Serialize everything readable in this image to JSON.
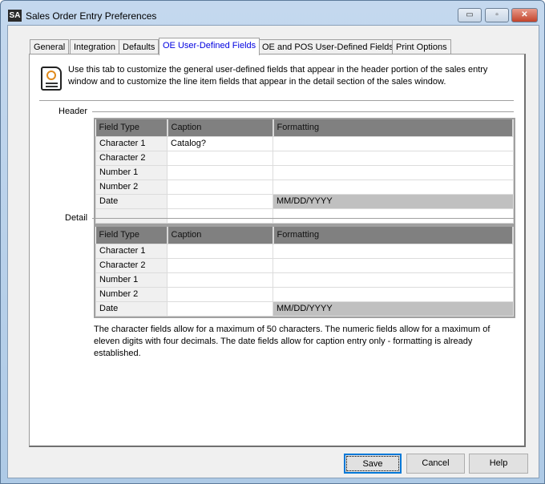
{
  "window": {
    "app_icon": "SA",
    "title": "Sales Order Entry Preferences",
    "minimize": "▭",
    "maximize": "▫",
    "close": "✕"
  },
  "tabs": [
    {
      "label": "General"
    },
    {
      "label": "Integration"
    },
    {
      "label": "Defaults"
    },
    {
      "label": "OE User-Defined Fields"
    },
    {
      "label": "OE and POS User-Defined Fields"
    },
    {
      "label": "Print Options"
    }
  ],
  "intro": "Use this tab to customize the general user-defined fields that appear in the header portion of the sales entry window and to customize the line item fields that appear in the detail section of the sales window.",
  "header": {
    "label": "Header",
    "columns": [
      "Field Type",
      "Caption",
      "Formatting"
    ],
    "rows": [
      {
        "type": "Character 1",
        "caption": "Catalog?",
        "format": ""
      },
      {
        "type": "Character 2",
        "caption": "",
        "format": ""
      },
      {
        "type": "Number 1",
        "caption": "",
        "format": ""
      },
      {
        "type": "Number 2",
        "caption": "",
        "format": ""
      },
      {
        "type": "Date",
        "caption": "",
        "format": "MM/DD/YYYY"
      }
    ]
  },
  "detail": {
    "label": "Detail",
    "columns": [
      "Field Type",
      "Caption",
      "Formatting"
    ],
    "rows": [
      {
        "type": "Character 1",
        "caption": "",
        "format": ""
      },
      {
        "type": "Character 2",
        "caption": "",
        "format": ""
      },
      {
        "type": "Number 1",
        "caption": "",
        "format": ""
      },
      {
        "type": "Number 2",
        "caption": "",
        "format": ""
      },
      {
        "type": "Date",
        "caption": "",
        "format": "MM/DD/YYYY"
      }
    ]
  },
  "note": "The character fields allow for a maximum of 50 characters.  The numeric fields allow for a maximum of eleven digits with four decimals.  The date fields allow for caption entry only - formatting is already established.",
  "buttons": {
    "save": "Save",
    "cancel": "Cancel",
    "help": "Help"
  }
}
